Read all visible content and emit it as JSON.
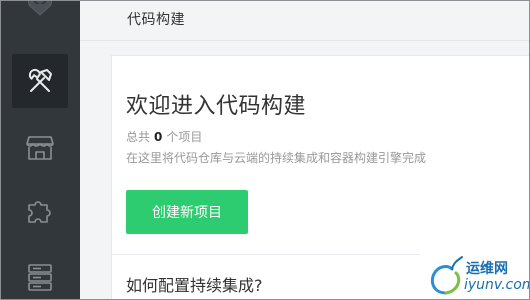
{
  "header": {
    "title": "代码构建"
  },
  "sidebar": {
    "logo_icon": "fox-logo-icon",
    "items": [
      {
        "name": "build-tools",
        "icon": "hammer-wrench-icon",
        "active": true
      },
      {
        "name": "store",
        "icon": "store-icon",
        "active": false
      },
      {
        "name": "plugins",
        "icon": "puzzle-icon",
        "active": false
      },
      {
        "name": "servers",
        "icon": "server-icon",
        "active": false
      }
    ]
  },
  "main": {
    "welcome_title": "欢迎进入代码构建",
    "project_count_prefix": "总共",
    "project_count": "0",
    "project_count_suffix": "个项目",
    "description": "在这里将代码仓库与云端的持续集成和容器构建引擎完成",
    "create_button": "创建新项目",
    "faq_title": "如何配置持续集成?"
  },
  "watermark": {
    "text_cn": "运维网",
    "text_en": "iyunv.com"
  },
  "colors": {
    "sidebar": "#32373c",
    "sidebar_active": "#24282c",
    "accent": "#2ecc71",
    "watermark": "#1a6fb0"
  }
}
